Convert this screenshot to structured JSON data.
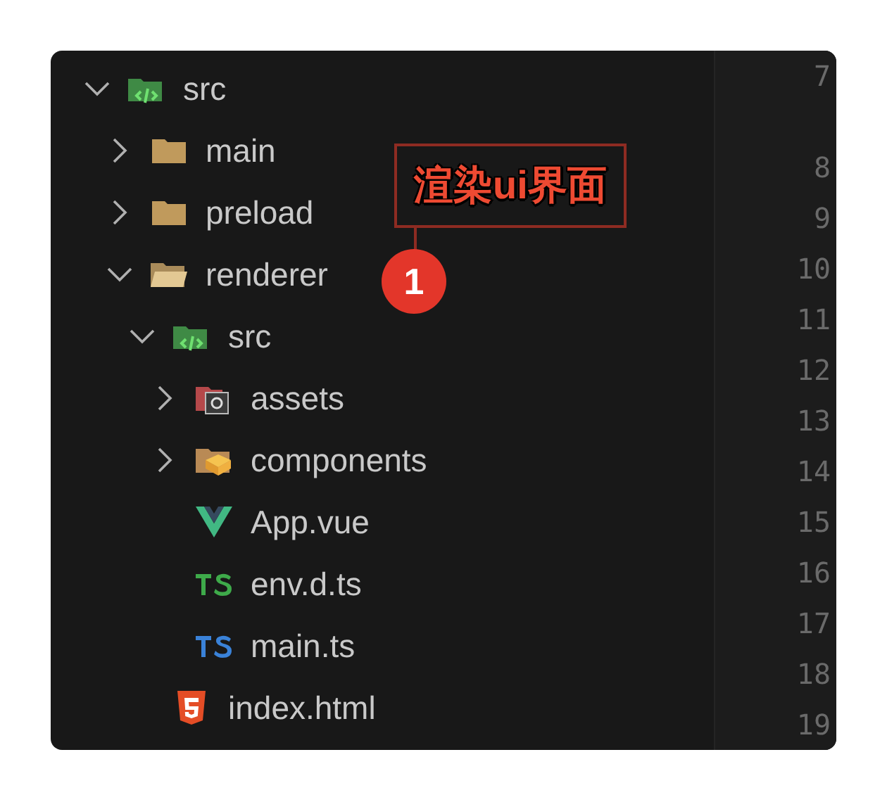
{
  "explorer": {
    "items": [
      {
        "label": "src",
        "kind": "folder-src",
        "expanded": true,
        "children": [
          {
            "label": "main",
            "kind": "folder",
            "expanded": false
          },
          {
            "label": "preload",
            "kind": "folder",
            "expanded": false
          },
          {
            "label": "renderer",
            "kind": "folder",
            "expanded": true,
            "children": [
              {
                "label": "src",
                "kind": "folder-src",
                "expanded": true,
                "children": [
                  {
                    "label": "assets",
                    "kind": "folder-assets",
                    "expanded": false
                  },
                  {
                    "label": "components",
                    "kind": "folder-components",
                    "expanded": false
                  },
                  {
                    "label": "App.vue",
                    "kind": "vue"
                  },
                  {
                    "label": "env.d.ts",
                    "kind": "dts"
                  },
                  {
                    "label": "main.ts",
                    "kind": "ts"
                  }
                ]
              },
              {
                "label": "index.html",
                "kind": "html"
              }
            ]
          }
        ]
      }
    ]
  },
  "gutter": {
    "lines": [
      {
        "number": "7",
        "wrapped": true
      },
      {
        "number": "8",
        "wrapped": false
      },
      {
        "number": "9",
        "wrapped": false
      },
      {
        "number": "10",
        "wrapped": false
      },
      {
        "number": "11",
        "wrapped": false
      },
      {
        "number": "12",
        "wrapped": false
      },
      {
        "number": "13",
        "wrapped": false
      },
      {
        "number": "14",
        "wrapped": false
      },
      {
        "number": "15",
        "wrapped": false
      },
      {
        "number": "16",
        "wrapped": false
      },
      {
        "number": "17",
        "wrapped": false
      },
      {
        "number": "18",
        "wrapped": false
      },
      {
        "number": "19",
        "wrapped": false
      }
    ]
  },
  "annotation": {
    "label": "渲染ui界面",
    "marker": "1"
  }
}
